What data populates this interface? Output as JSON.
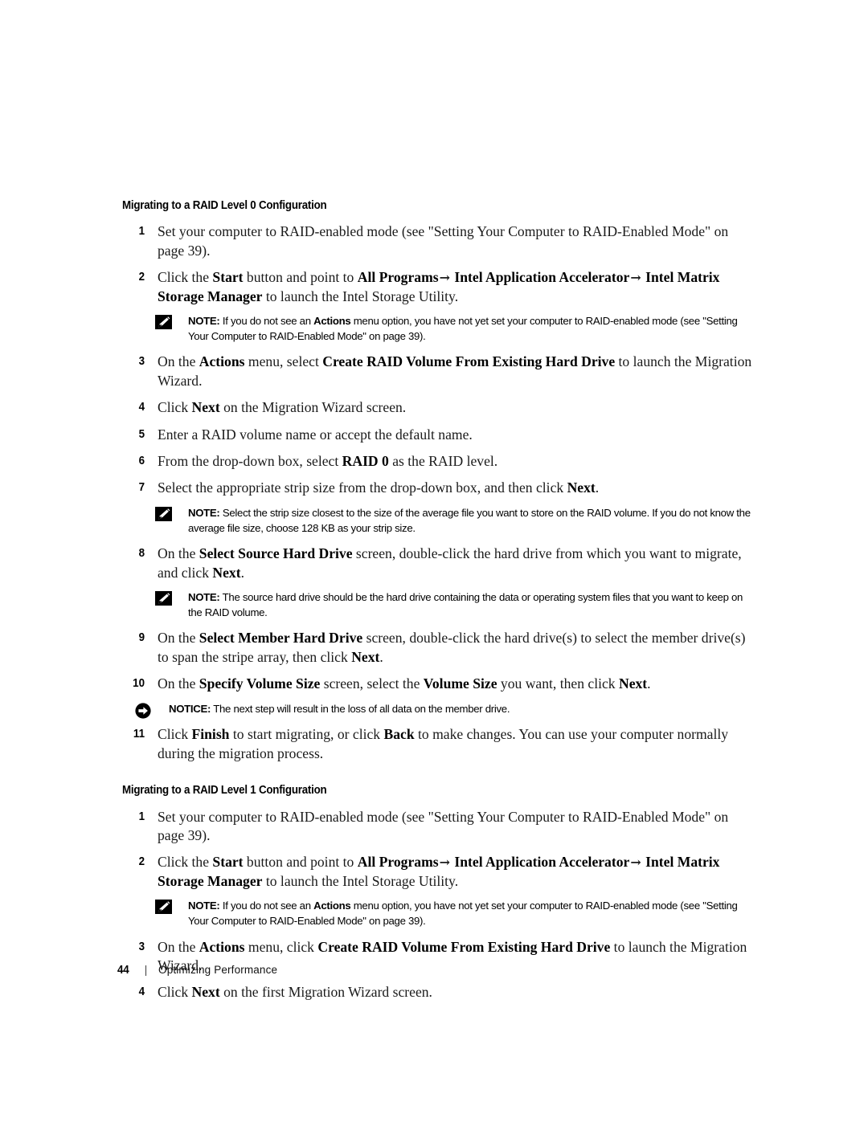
{
  "document": {
    "footer": {
      "page_number": "44",
      "separator": "|",
      "chapter": "Optimizing Performance"
    }
  },
  "sections": [
    {
      "heading": "Migrating to a RAID Level 0 Configuration",
      "blocks": [
        {
          "type": "step",
          "number": "1",
          "text": "Set your computer to RAID-enabled mode (see \"Setting Your Computer to RAID-Enabled Mode\" on page 39)."
        },
        {
          "type": "step",
          "number": "2",
          "text": "Click the Start button and point to All Programs→ Intel Application Accelerator→ Intel Matrix Storage Manager to launch the Intel Storage Utility."
        },
        {
          "type": "note",
          "icon": "pencil-icon",
          "label": "NOTE:",
          "text": "If you do not see an Actions menu option, you have not yet set your computer to RAID-enabled mode (see \"Setting Your Computer to RAID-Enabled Mode\" on page 39)."
        },
        {
          "type": "step",
          "number": "3",
          "text": "On the Actions menu, select Create RAID Volume From Existing Hard Drive to launch the Migration Wizard."
        },
        {
          "type": "step",
          "number": "4",
          "text": "Click Next on the Migration Wizard screen."
        },
        {
          "type": "step",
          "number": "5",
          "text": "Enter a RAID volume name or accept the default name."
        },
        {
          "type": "step",
          "number": "6",
          "text": "From the drop-down box, select RAID 0 as the RAID level."
        },
        {
          "type": "step",
          "number": "7",
          "text": "Select the appropriate strip size from the drop-down box, and then click Next."
        },
        {
          "type": "note",
          "icon": "pencil-icon",
          "label": "NOTE:",
          "text": "Select the strip size closest to the size of the average file you want to store on the RAID volume. If you do not know the average file size, choose 128 KB as your strip size."
        },
        {
          "type": "step",
          "number": "8",
          "text": "On the Select Source Hard Drive screen, double-click the hard drive from which you want to migrate, and click Next."
        },
        {
          "type": "note",
          "icon": "pencil-icon",
          "label": "NOTE:",
          "text": "The source hard drive should be the hard drive containing the data or operating system files that you want to keep on the RAID volume."
        },
        {
          "type": "step",
          "number": "9",
          "text": "On the Select Member Hard Drive screen, double-click the hard drive(s) to select the member drive(s) to span the stripe array, then click Next."
        },
        {
          "type": "step",
          "number": "10",
          "text": "On the Specify Volume Size screen, select the Volume Size you want, then click Next."
        },
        {
          "type": "notice",
          "icon": "arrow-circle-icon",
          "label": "NOTICE:",
          "text": "The next step will result in the loss of all data on the member drive."
        },
        {
          "type": "step",
          "number": "11",
          "text": "Click Finish to start migrating, or click Back to make changes. You can use your computer normally during the migration process."
        }
      ]
    },
    {
      "heading": "Migrating to a RAID Level 1 Configuration",
      "blocks": [
        {
          "type": "step",
          "number": "1",
          "text": "Set your computer to RAID-enabled mode (see \"Setting Your Computer to RAID-Enabled Mode\" on page 39)."
        },
        {
          "type": "step",
          "number": "2",
          "text": "Click the Start button and point to All Programs→ Intel Application Accelerator→ Intel Matrix Storage Manager to launch the Intel Storage Utility."
        },
        {
          "type": "note",
          "icon": "pencil-icon",
          "label": "NOTE:",
          "text": "If you do not see an Actions menu option, you have not yet set your computer to RAID-enabled mode (see \"Setting Your Computer to RAID-Enabled Mode\" on page 39)."
        },
        {
          "type": "step",
          "number": "3",
          "text": "On the Actions menu, click Create RAID Volume From Existing Hard Drive to launch the Migration Wizard."
        },
        {
          "type": "step",
          "number": "4",
          "text": "Click Next on the first Migration Wizard screen."
        }
      ]
    }
  ],
  "emphasis_terms": [
    "Start",
    "All Programs",
    "Intel Application Accelerator",
    "Intel Matrix Storage Manager",
    "Actions",
    "Create RAID Volume From Existing Hard Drive",
    "Next",
    "RAID 0",
    "Select Source Hard Drive",
    "Select Member Hard Drive",
    "Specify Volume Size",
    "Volume Size",
    "Finish",
    "Back"
  ]
}
